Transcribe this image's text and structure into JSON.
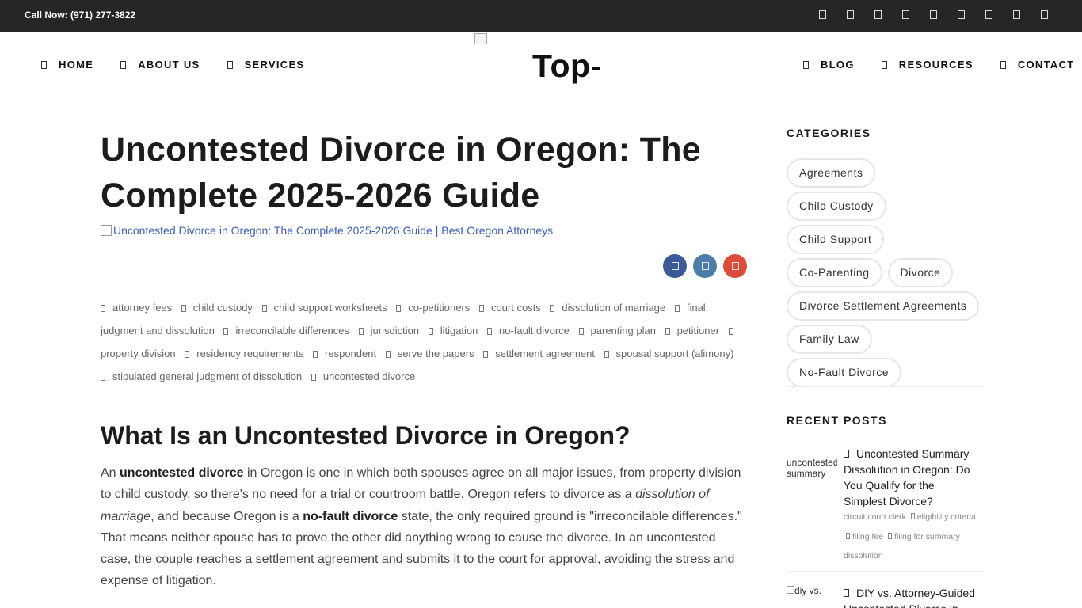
{
  "topbar": {
    "call_text": "Call Now: (971) 277-3822",
    "social_icons": [
      "square-icon",
      "square-icon",
      "square-icon",
      "square-icon",
      "square-icon",
      "square-icon",
      "square-icon",
      "square-icon",
      "square-icon"
    ]
  },
  "nav": {
    "left": [
      {
        "label": "HOME",
        "icon": "home-icon"
      },
      {
        "label": "ABOUT US",
        "icon": "user-icon"
      },
      {
        "label": "SERVICES",
        "icon": "briefcase-icon"
      }
    ],
    "right": [
      {
        "label": "BLOG",
        "icon": "pen-icon"
      },
      {
        "label": "RESOURCES",
        "icon": "book-icon"
      },
      {
        "label": "CONTACT",
        "icon": "envelope-icon"
      }
    ],
    "logo_text": "Top-"
  },
  "article": {
    "title": "Uncontested Divorce in Oregon: The Complete 2025-2026 Guide",
    "image_alt": "Uncontested Divorce in Oregon: The Complete 2025-2026 Guide | Best Oregon Attorneys",
    "share_colors": {
      "facebook": "#3b5998",
      "twitter": "#4a7ea8",
      "google": "#dd4b39"
    },
    "tags": [
      "attorney fees",
      "child custody",
      "child support worksheets",
      "co-petitioners",
      "court costs",
      "dissolution of marriage",
      "final judgment and dissolution",
      "irreconcilable differences",
      "jurisdiction",
      "litigation",
      "no-fault divorce",
      "parenting plan",
      "petitioner",
      "property division",
      "residency requirements",
      "respondent",
      "serve the papers",
      "settlement agreement",
      "spousal support (alimony)",
      "stipulated general judgment of dissolution",
      "uncontested divorce"
    ],
    "h2": "What Is an Uncontested Divorce in Oregon?",
    "para": {
      "t1": "An ",
      "b1": "uncontested divorce",
      "t2": " in Oregon is one in which both spouses agree on all major issues, from property division to child custody, so there's no need for a trial or courtroom battle. Oregon refers to divorce as a ",
      "i1": "dissolution of marriage",
      "t3": ", and because Oregon is a ",
      "b2": "no-fault divorce",
      "t4": " state, the only required ground is \"irreconcilable differences.\" That means neither spouse has to prove the other did anything wrong to cause the divorce. In an uncontested case, the couple reaches a settlement agreement and submits it to the court for approval, avoiding the stress and expense of litigation."
    }
  },
  "sidebar": {
    "categories_heading": "CATEGORIES",
    "categories": [
      "Agreements",
      "Child Custody",
      "Child Support",
      "Co-Parenting",
      "Divorce",
      "Divorce Settlement Agreements",
      "Family Law",
      "No-Fault Divorce"
    ],
    "recent_heading": "RECENT POSTS",
    "posts": [
      {
        "thumb_alt": "uncontested summary",
        "title": "Uncontested Summary Dissolution in Oregon: Do You Qualify for the Simplest Divorce?",
        "tags": [
          "circuit court clerk",
          "eligibility criteria",
          "filing fee",
          "filing for summary dissolution"
        ]
      },
      {
        "thumb_alt": "diy vs.",
        "title": "DIY vs. Attorney-Guided Uncontested Divorce in",
        "tags": []
      }
    ]
  }
}
